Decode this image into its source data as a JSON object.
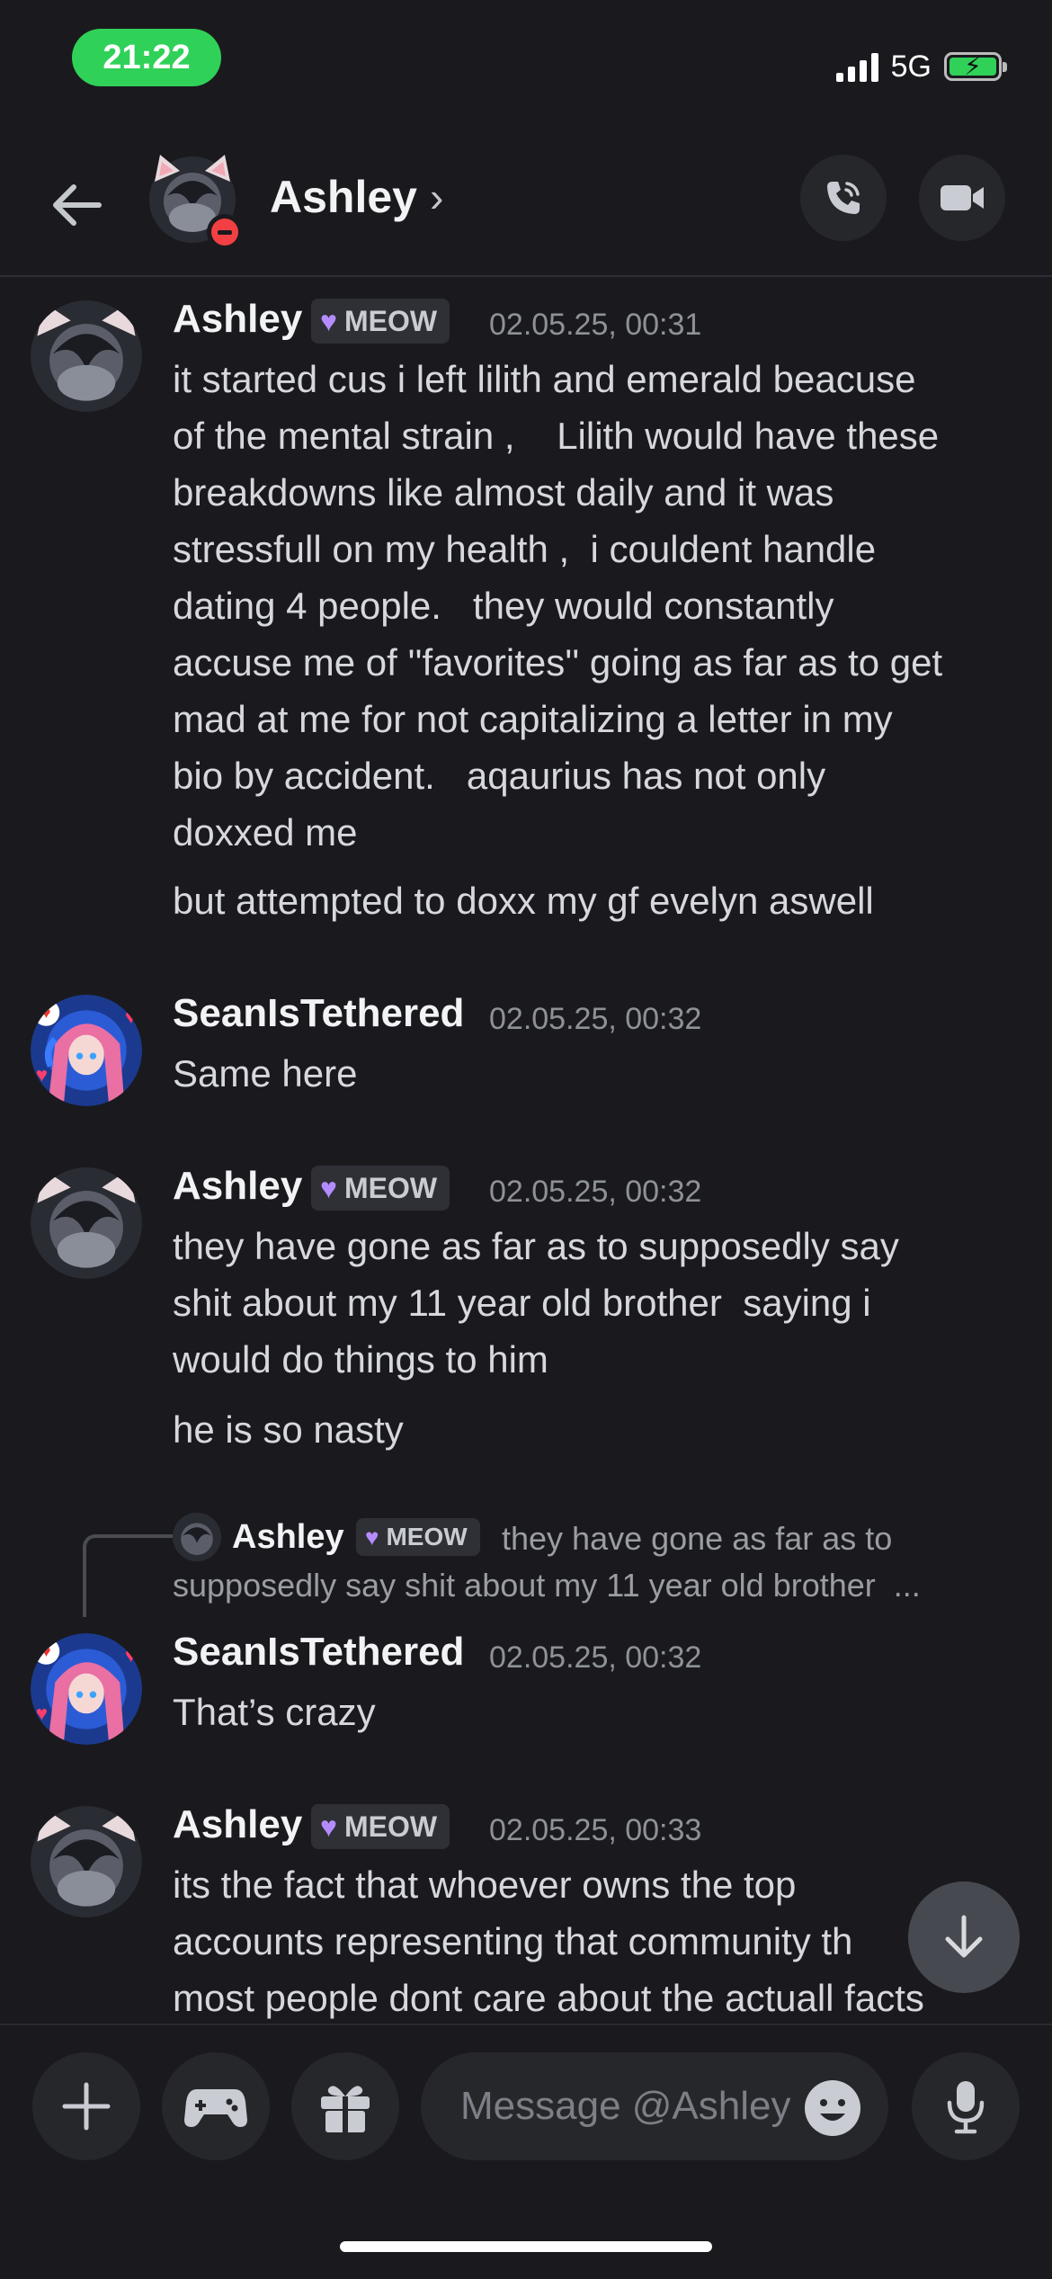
{
  "status": {
    "time": "21:22",
    "network": "5G",
    "battery_color": "#30d158"
  },
  "header": {
    "name": "Ashley",
    "chevron": "›",
    "call_icon": "phone-icon",
    "video_icon": "video-icon"
  },
  "messages": [
    {
      "author": "Ashley",
      "tag": "MEOW",
      "timestamp": "02.05.25, 00:31",
      "lines": [
        "it started cus i left lilith and emerald beacuse",
        "of the mental strain ,    Lilith would have these",
        "breakdowns like almost daily and it was",
        "stressfull on my health ,  i couldent handle",
        "dating 4 people.   they would constantly",
        "accuse me of ''favorites'' going as far as to get",
        "mad at me for not capitalizing a letter in my",
        "bio by accident.   aqaurius has not only",
        "doxxed me"
      ],
      "followup": "but attempted to doxx my gf evelyn aswell"
    },
    {
      "author": "SeanIsTethered",
      "timestamp": "02.05.25, 00:32",
      "lines": [
        "Same here"
      ]
    },
    {
      "author": "Ashley",
      "tag": "MEOW",
      "timestamp": "02.05.25, 00:32",
      "lines": [
        "they have gone as far as to supposedly say",
        "shit about my 11 year old brother  saying i",
        "would do things to him"
      ],
      "followup": "he is so nasty"
    },
    {
      "author": "SeanIsTethered",
      "timestamp": "02.05.25, 00:32",
      "lines": [
        "That’s crazy"
      ],
      "reply": {
        "author": "Ashley",
        "tag": "MEOW",
        "line1": "they have gone as far as to",
        "line2": "supposedly say shit about my 11 year old brother  ..."
      }
    },
    {
      "author": "Ashley",
      "tag": "MEOW",
      "timestamp": "02.05.25, 00:33",
      "lines": [
        "its the fact that whoever owns the top",
        "accounts representing that community th",
        "most people dont care about the actuall facts"
      ]
    }
  ],
  "composer": {
    "placeholder": "Message @Ashley"
  }
}
